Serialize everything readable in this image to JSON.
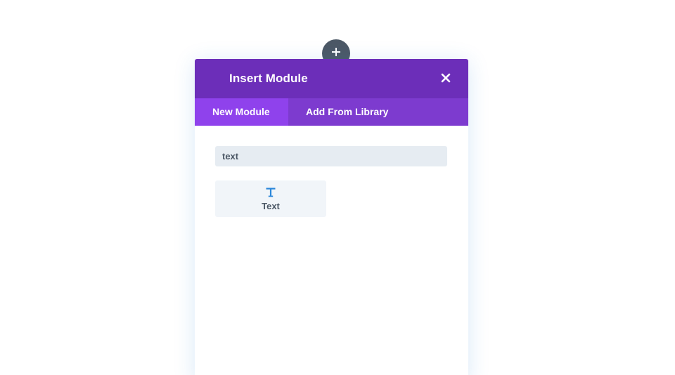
{
  "modal": {
    "title": "Insert Module",
    "tabs": [
      {
        "label": "New Module",
        "active": true
      },
      {
        "label": "Add From Library",
        "active": false
      }
    ]
  },
  "search": {
    "value": "text"
  },
  "results": [
    {
      "label": "Text",
      "icon": "text-icon"
    }
  ],
  "colors": {
    "header": "#6c2eb9",
    "tabs_bar": "#7d3bcf",
    "tab_active": "#8f42ec",
    "icon_accent": "#2b87da",
    "add_button": "#4c5866"
  }
}
